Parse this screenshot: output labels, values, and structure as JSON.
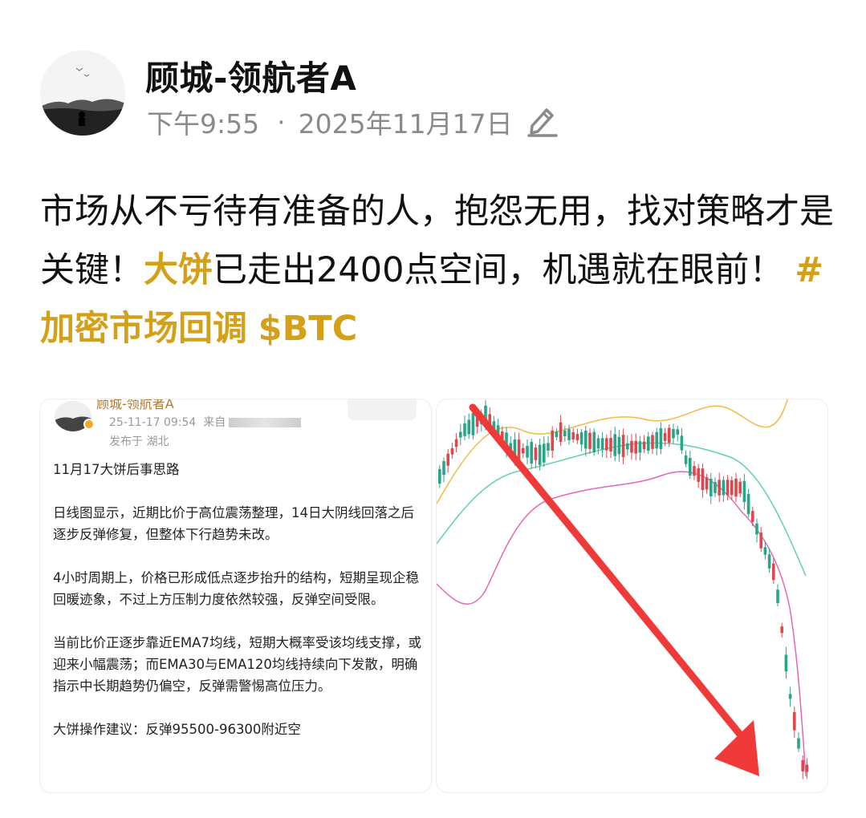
{
  "author": {
    "name": "顾城-领航者A",
    "time": "下午9:55",
    "separator": "·",
    "date": "2025年11月17日"
  },
  "post": {
    "text_1": " 市场从不亏待有准备的人，抱怨无用，找对策略才是关键！",
    "highlight": "大饼",
    "text_2": "已走出2400点空间，机遇就在眼前！",
    "hashtag": "#加密市场回调",
    "cashtag": "$BTC"
  },
  "screenshot_card": {
    "top_name": "顾城-领航者A",
    "timestamp": "25-11-17 09:54",
    "source_prefix": "来自",
    "location": "发布于 湖北",
    "paragraphs": [
      "11月17大饼后事思路",
      "日线图显示，近期比价于高位震荡整理，14日大阴线回落之后逐步反弹修复，但整体下行趋势未改。",
      "4小时周期上，价格已形成低点逐步抬升的结构，短期呈现企稳回暖迹象，不过上方压制力度依然较强，反弹空间受限。",
      "当前比价正逐步靠近EMA7均线，短期大概率受该均线支撑，或迎来小幅震荡；而EMA30与EMA120均线持续向下发散，明确指示中长期趋势仍偏空，反弹需警惕高位压力。",
      "大饼操作建议：反弹95500-96300附近空"
    ]
  },
  "colors": {
    "highlight": "#d4a017",
    "candle_up": "#e0474c",
    "candle_down": "#27a688",
    "arrow": "#f03a3a"
  },
  "icons": [
    "pencil-edit-icon",
    "verified-badge-icon",
    "red-arrow-down-icon"
  ]
}
